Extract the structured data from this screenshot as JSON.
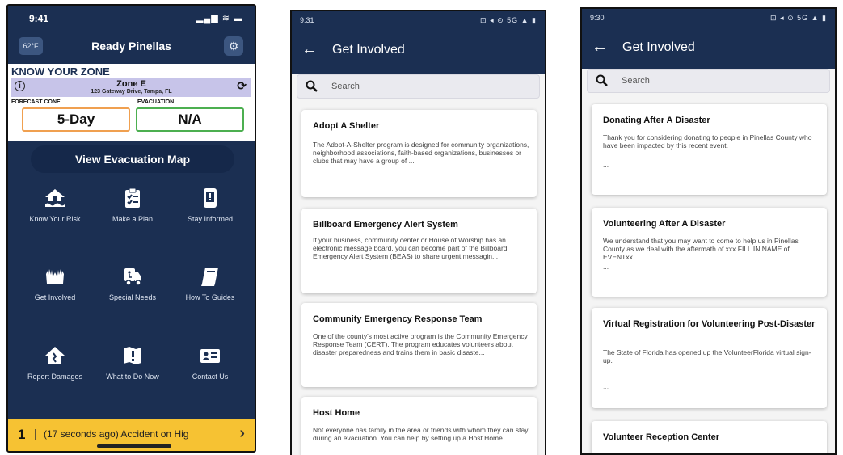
{
  "phone1": {
    "time": "9:41",
    "status_icons": "▂▄▆ ≋ ▬",
    "temperature": "62°F",
    "title": "Ready Pinellas",
    "know_your_zone": "KNOW YOUR ZONE",
    "zone_name": "Zone E",
    "zone_address": "123 Gateway Drive, Tampa, FL",
    "forecast_cone_label": "FORECAST CONE",
    "forecast_cone_value": "5-Day",
    "evacuation_label": "EVACUATION",
    "evacuation_value": "N/A",
    "evac_map_button": "View Evacuation Map",
    "tiles": [
      {
        "label": "Know Your Risk",
        "icon": "house-flood-icon"
      },
      {
        "label": "Make a Plan",
        "icon": "clipboard-checklist-icon"
      },
      {
        "label": "Stay Informed",
        "icon": "phone-alert-icon"
      },
      {
        "label": "Get Involved",
        "icon": "hands-raised-icon"
      },
      {
        "label": "Special Needs",
        "icon": "ambulance-accessible-icon"
      },
      {
        "label": "How To Guides",
        "icon": "book-icon"
      },
      {
        "label": "Report Damages",
        "icon": "damaged-house-icon"
      },
      {
        "label": "What to Do Now",
        "icon": "map-alert-icon"
      },
      {
        "label": "Contact Us",
        "icon": "contact-card-icon"
      }
    ],
    "ticker_count": "1",
    "ticker_text": "(17 seconds ago) Accident on Hig"
  },
  "phone2": {
    "time": "9:31",
    "status_icons": "⊡ ◂ ⊙ 5G ▲ ▮",
    "title": "Get Involved",
    "search_placeholder": "Search",
    "cards": [
      {
        "title": "Adopt A Shelter",
        "body": "The Adopt-A-Shelter program is designed for community organizations, neighborhood associations, faith-based organizations, businesses or clubs that may have a group of ..."
      },
      {
        "title": "Billboard Emergency Alert System",
        "body": "If your business, community center or House of Worship has an electronic message board, you can become part of the Billboard Emergency Alert System (BEAS) to share urgent messagin..."
      },
      {
        "title": "Community Emergency Response Team",
        "body": "One of the county's most active program is the Community Emergency Response Team (CERT). The program educates volunteers about disaster preparedness and trains them in basic disaste..."
      },
      {
        "title": "Host Home",
        "body": "Not everyone has family in the area or friends with whom they can stay during an evacuation. You can help by setting up a Host Home..."
      }
    ]
  },
  "phone3": {
    "time": "9:30",
    "status_icons": "⊡ ◂ ⊙ 5G ▲ ▮",
    "title": "Get Involved",
    "search_placeholder": "Search",
    "cards": [
      {
        "title": "Donating After A Disaster",
        "body": "Thank you for considering donating to people in Pinellas County who have been impacted by this recent event.",
        "ellipsis": "..."
      },
      {
        "title": "Volunteering After A Disaster",
        "body": "We understand that you may want to come to help us in Pinellas County as we deal with the aftermath of xxx.FILL IN NAME of EVENTxx.",
        "ellipsis": "..."
      },
      {
        "title": "Virtual Registration for Volunteering Post-Disaster",
        "body": "The State of Florida has opened up the VolunteerFlorida virtual sign-up.",
        "ellipsis": "..."
      },
      {
        "title": "Volunteer Reception Center",
        "body": ""
      }
    ]
  },
  "colors": {
    "navy": "#1b2f52",
    "zone_bar": "#c7c4e9",
    "forecast_border": "#f0a050",
    "evac_border": "#4caf50",
    "ticker": "#f6c233"
  }
}
